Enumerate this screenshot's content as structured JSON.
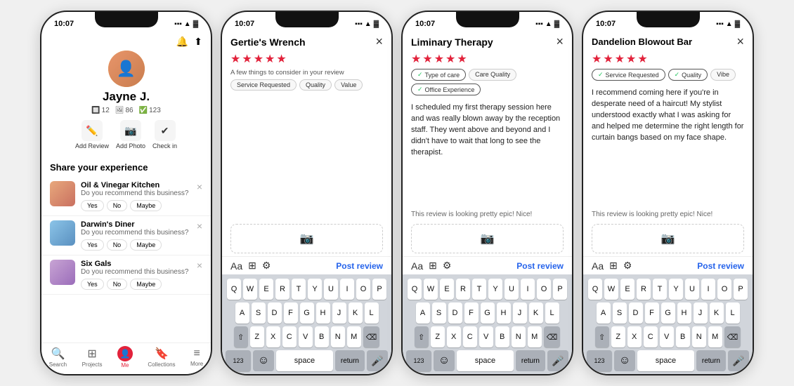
{
  "phone1": {
    "time": "10:07",
    "profile_name": "Jayne J.",
    "stats": [
      "12",
      "86",
      "123"
    ],
    "actions": [
      "Add Review",
      "Add Photo",
      "Check in"
    ],
    "section_title": "Share your experience",
    "experiences": [
      {
        "name": "Oil & Vinegar Kitchen",
        "question": "Do you recommend this business?"
      },
      {
        "name": "Darwin's Diner",
        "question": "Do you recommend this business?"
      },
      {
        "name": "Six Gals",
        "question": "Do you recommend this business?"
      }
    ],
    "buttons": [
      "Yes",
      "No",
      "Maybe"
    ],
    "nav_items": [
      "Search",
      "Projects",
      "Me",
      "Collections",
      "More"
    ]
  },
  "phone2": {
    "time": "10:07",
    "title": "Gertie's Wrench",
    "consider_text": "A few things to consider in your review",
    "tags": [
      "Service Requested",
      "Quality",
      "Value"
    ],
    "stars": 5,
    "post_label": "Post review"
  },
  "phone3": {
    "time": "10:07",
    "title": "Liminary Therapy",
    "tags": [
      {
        "label": "Type of care",
        "checked": true
      },
      {
        "label": "Care Quality",
        "checked": false
      },
      {
        "label": "Office Experience",
        "checked": true
      }
    ],
    "stars": 5,
    "review_text": "I scheduled my first therapy session here and was really blown away by the reception staff. They went above and beyond and I didn't have to wait that long to see the therapist.",
    "hint": "This review is looking pretty epic! Nice!",
    "post_label": "Post review"
  },
  "phone4": {
    "time": "10:07",
    "title": "Dandelion Blowout Bar",
    "tags": [
      {
        "label": "Service Requested",
        "checked": true
      },
      {
        "label": "Quality",
        "checked": true
      },
      {
        "label": "Vibe",
        "checked": false
      }
    ],
    "stars": 5,
    "review_text": "I recommend coming here if you're in desperate need of a haircut! My stylist understood exactly what I was asking for and helped me determine the right length for curtain bangs based on my face shape.",
    "hint": "This review is looking pretty epic! Nice!",
    "post_label": "Post review"
  },
  "keyboard": {
    "rows": [
      [
        "Q",
        "W",
        "E",
        "R",
        "T",
        "Y",
        "U",
        "I",
        "O",
        "P"
      ],
      [
        "A",
        "S",
        "D",
        "F",
        "G",
        "H",
        "J",
        "K",
        "L"
      ],
      [
        "Z",
        "X",
        "C",
        "V",
        "B",
        "N",
        "M"
      ]
    ],
    "bottom": [
      "123",
      "space",
      "return"
    ]
  }
}
